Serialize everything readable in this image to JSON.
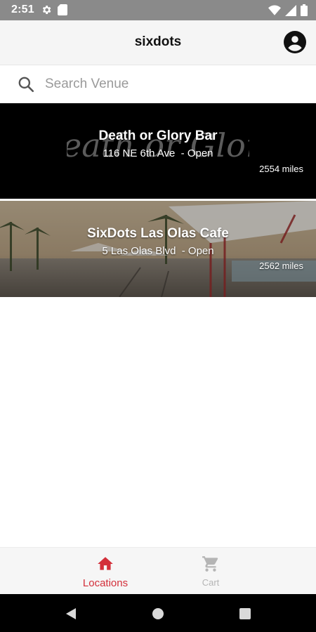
{
  "status_bar": {
    "time": "2:51",
    "icons": [
      "settings-icon",
      "sd-card-icon",
      "wifi-icon",
      "signal-icon",
      "battery-icon"
    ]
  },
  "app_bar": {
    "title": "sixdots",
    "profile_icon": "account-circle-icon"
  },
  "search": {
    "placeholder": "Search Venue",
    "value": "",
    "icon": "search-icon"
  },
  "venues": [
    {
      "name": "Death or Glory Bar",
      "address": "116 NE 6th Ave",
      "status": " - Open",
      "address_line": "116 NE 6th Ave  - Open",
      "distance": "2554  miles",
      "logo_text": "Death or Glory"
    },
    {
      "name": "SixDots Las Olas Cafe",
      "address": "5 Las Olas Blvd",
      "status": " - Open",
      "address_line": "5 Las Olas Blvd  - Open",
      "distance": "2562  miles"
    }
  ],
  "bottom_nav": {
    "items": [
      {
        "label": "Locations",
        "icon": "home-icon",
        "active": true
      },
      {
        "label": "Cart",
        "icon": "cart-icon",
        "active": false
      }
    ]
  },
  "colors": {
    "accent": "#d32f3a",
    "status_bar": "#8a8a8a",
    "app_bar": "#f5f5f5",
    "inactive": "#b5b5b5"
  }
}
